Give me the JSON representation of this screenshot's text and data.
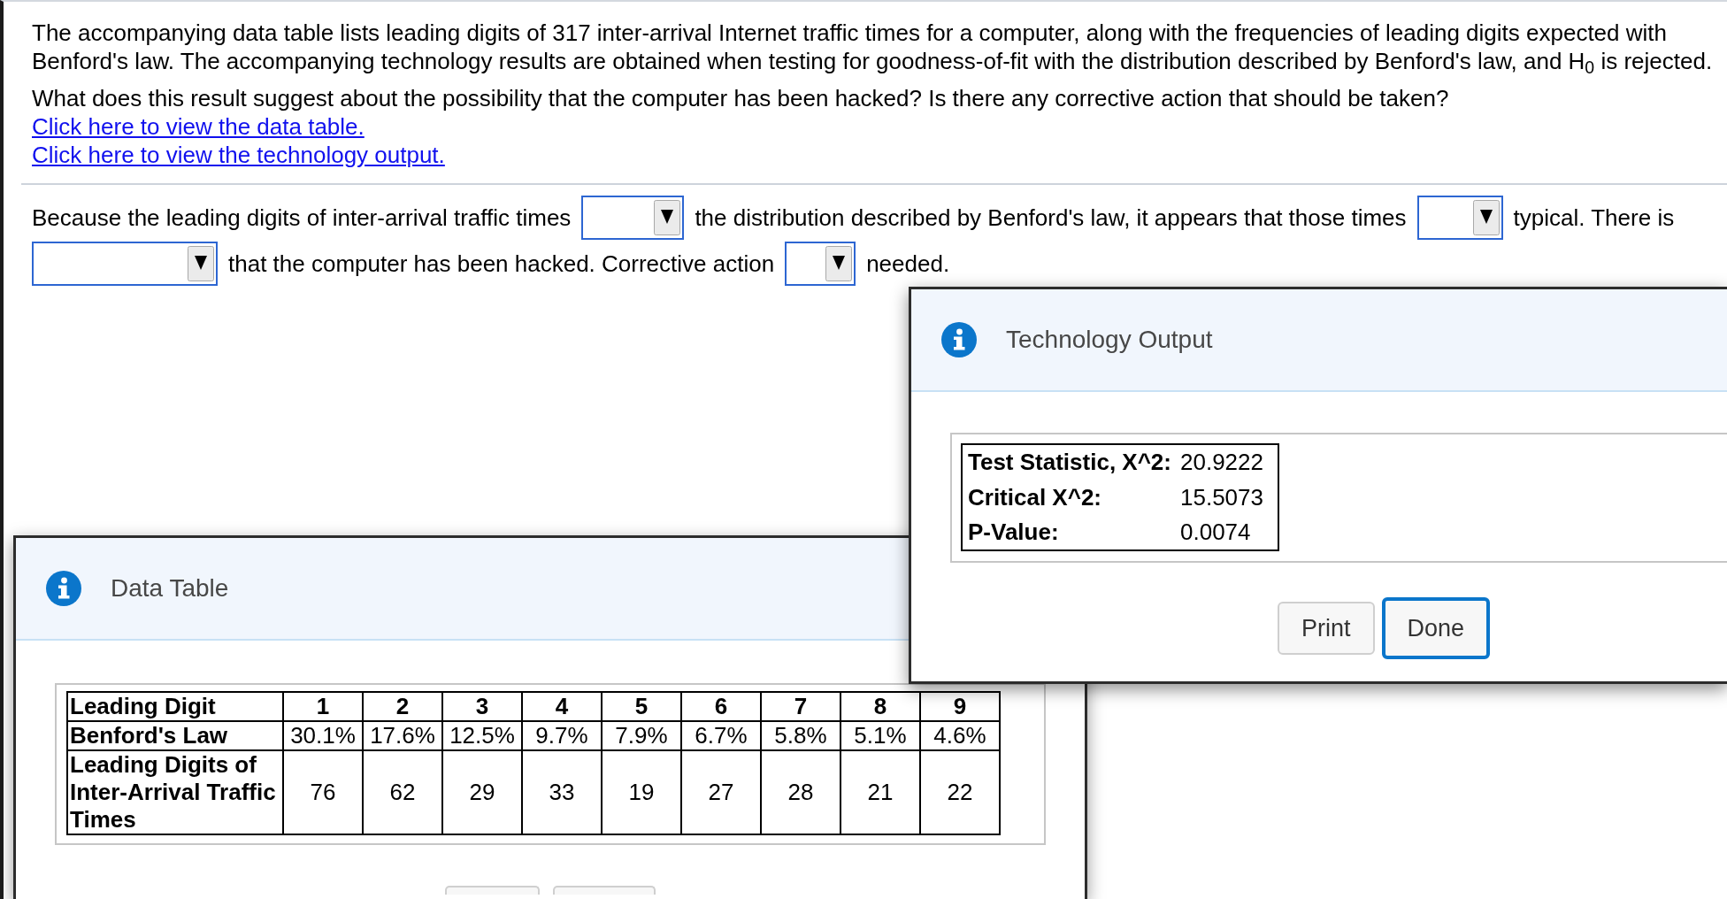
{
  "question": {
    "paragraphs": [
      "The accompanying data table lists leading digits of 317 inter-arrival Internet traffic times for a computer, along with the frequencies of leading digits expected with Benford's law. The accompanying technology results are obtained when testing for goodness-of-fit with the distribution described by Benford's law, and H$_{0}$ is rejected.",
      "What does this result suggest about the possibility that the computer has been hacked? Is there any corrective action that should be taken?"
    ],
    "links": [
      "Click here to view the data table.",
      "Click here to view the technology output."
    ]
  },
  "answer": {
    "parts": [
      {
        "kind": "text",
        "text": "Because the leading digits of inter-arrival traffic times"
      },
      {
        "kind": "dropdown"
      },
      {
        "kind": "text",
        "text": "the distribution described by Benford's law, it appears that those times"
      },
      {
        "kind": "dropdown"
      },
      {
        "kind": "text",
        "text": "typical. There is"
      },
      {
        "kind": "dropdown"
      },
      {
        "kind": "text",
        "text": "that the computer has been hacked. Corrective action"
      },
      {
        "kind": "dropdown"
      },
      {
        "kind": "text",
        "text": "needed."
      }
    ]
  },
  "technology_output": {
    "title": "Technology Output",
    "rows": [
      {
        "label": "Test Statistic, X^2:",
        "value": "20.9222"
      },
      {
        "label": "Critical X^2:",
        "value": "15.5073"
      },
      {
        "label": "P-Value:",
        "value": "0.0074"
      }
    ],
    "buttons": [
      {
        "label": "Print",
        "focused": false
      },
      {
        "label": "Done",
        "focused": true
      }
    ]
  },
  "data_table": {
    "title": "Data Table",
    "rows": [
      {
        "kind": "header",
        "label": "Leading Digit",
        "cells": [
          "1",
          "2",
          "3",
          "4",
          "5",
          "6",
          "7",
          "8",
          "9"
        ]
      },
      {
        "kind": "data",
        "label": "Benford's Law",
        "cells": [
          "30.1%",
          "17.6%",
          "12.5%",
          "9.7%",
          "7.9%",
          "6.7%",
          "5.8%",
          "5.1%",
          "4.6%"
        ]
      },
      {
        "kind": "data",
        "label": "Leading Digits of Inter-Arrival Traffic Times",
        "cells": [
          "76",
          "62",
          "29",
          "33",
          "19",
          "27",
          "28",
          "21",
          "22"
        ]
      }
    ],
    "buttons": [
      {
        "kind": "button"
      },
      {
        "kind": "button"
      }
    ]
  }
}
